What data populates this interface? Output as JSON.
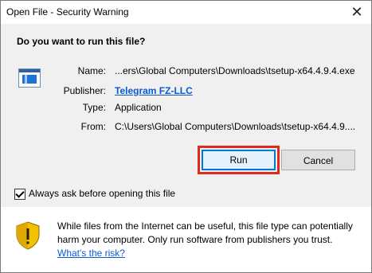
{
  "window": {
    "title": "Open File - Security Warning"
  },
  "content": {
    "question": "Do you want to run this file?",
    "fields": {
      "name_label": "Name:",
      "name_value": "...ers\\Global Computers\\Downloads\\tsetup-x64.4.9.4.exe",
      "publisher_label": "Publisher:",
      "publisher_value": "Telegram FZ-LLC",
      "type_label": "Type:",
      "type_value": "Application",
      "from_label": "From:",
      "from_value": "C:\\Users\\Global Computers\\Downloads\\tsetup-x64.4.9...."
    },
    "buttons": {
      "run": "Run",
      "cancel": "Cancel"
    },
    "checkbox": {
      "label": "Always ask before opening this file",
      "checked": true
    }
  },
  "warning": {
    "text": "While files from the Internet can be useful, this file type can potentially harm your computer. Only run software from publishers you trust.",
    "risk_link": "What's the risk?"
  },
  "colors": {
    "highlight": "#e02a1b",
    "link": "#0a5bd3",
    "primary_border": "#0078d7"
  },
  "icons": {
    "file": "application-file-icon",
    "shield": "security-shield-icon",
    "close": "close-icon"
  }
}
